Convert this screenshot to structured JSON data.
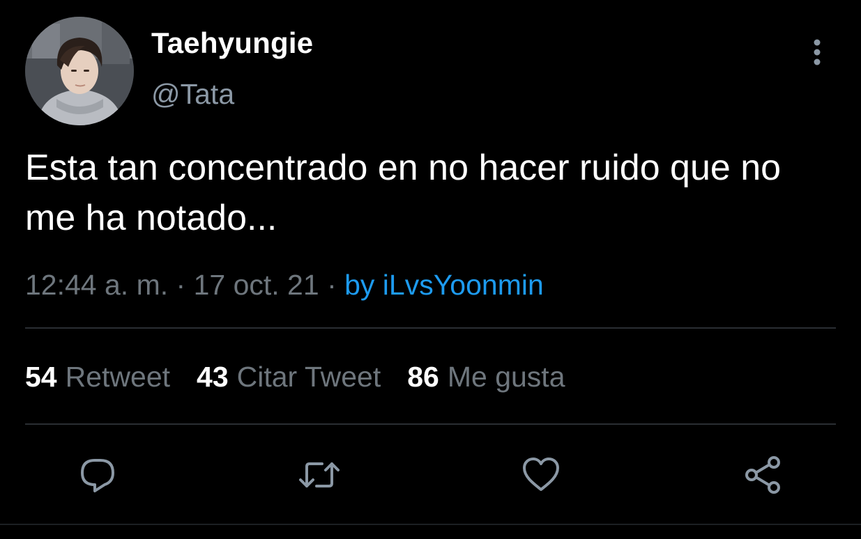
{
  "author": {
    "display_name": "Taehyungie",
    "handle": "@Tata"
  },
  "tweet": {
    "text": "Esta tan concentrado en no hacer ruido que no me ha notado...",
    "time": "12:44 a. m.",
    "date": "17 oct. 21",
    "source": "by iLvsYoonmin"
  },
  "stats": [
    {
      "count": "54",
      "label": "Retweet"
    },
    {
      "count": "43",
      "label": "Citar Tweet"
    },
    {
      "count": "86",
      "label": "Me gusta"
    }
  ],
  "actions": [
    {
      "icon": "reply-icon"
    },
    {
      "icon": "retweet-icon"
    },
    {
      "icon": "heart-icon"
    },
    {
      "icon": "share-icon"
    }
  ],
  "colors": {
    "background": "#000000",
    "text": "#ffffff",
    "muted": "#6e767d",
    "accent": "#1d9bf0",
    "icon": "#8b98a5",
    "divider": "#2a2e33"
  }
}
